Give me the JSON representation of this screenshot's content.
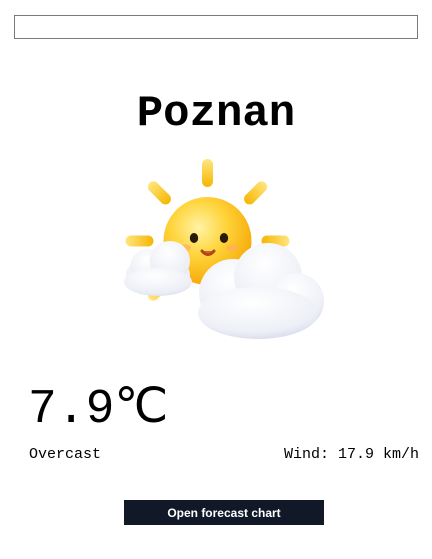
{
  "search": {
    "value": "",
    "placeholder": ""
  },
  "city": {
    "name": "Poznan"
  },
  "weather": {
    "icon": "sun-behind-clouds-icon",
    "temperature": "7.9℃",
    "condition": "Overcast",
    "wind": "Wind: 17.9 km/h"
  },
  "actions": {
    "forecast_button_label": "Open forecast chart"
  },
  "colors": {
    "button_bg": "#111827",
    "button_text": "#ffffff",
    "sun": "#ffcc33",
    "cloud": "#f4f4fa"
  }
}
